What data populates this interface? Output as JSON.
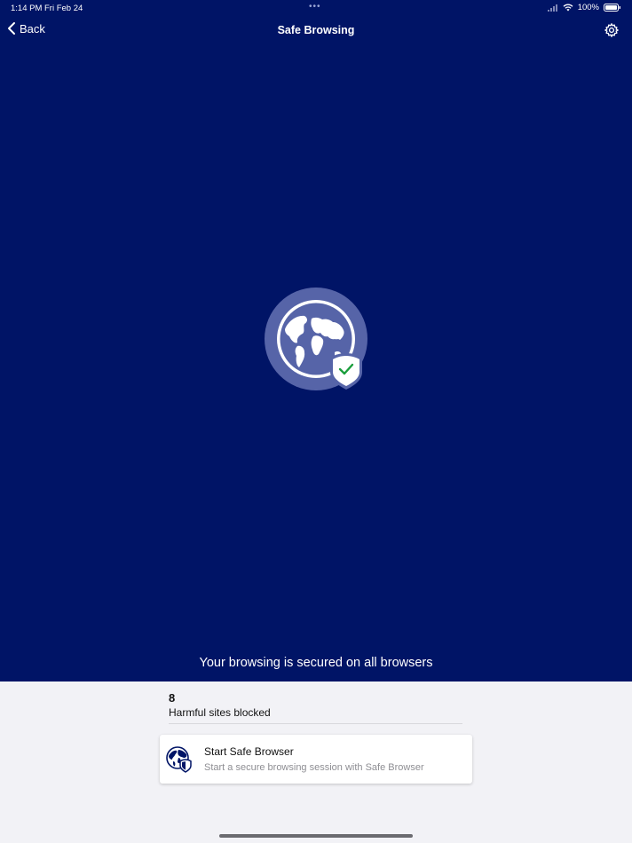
{
  "status_bar": {
    "time": "1:14 PM",
    "date": "Fri Feb 24",
    "battery": "100%",
    "icons": [
      "signal-icon",
      "wifi-icon",
      "battery-icon"
    ]
  },
  "nav": {
    "back_label": "Back",
    "title": "Safe Browsing",
    "settings_icon": "gear-icon"
  },
  "hero": {
    "icon": "globe-shield-check-icon",
    "message": "Your browsing is secured on all browsers"
  },
  "stats": {
    "count": "8",
    "label": "Harmful sites blocked"
  },
  "card": {
    "icon": "globe-shield-icon",
    "title": "Start Safe Browser",
    "subtitle": "Start a secure browsing session with Safe Browser"
  },
  "colors": {
    "header_bg": "#001466",
    "page_bg": "#f2f2f6",
    "check_green": "#1a9e3c",
    "globe_circle": "#5664a8"
  }
}
